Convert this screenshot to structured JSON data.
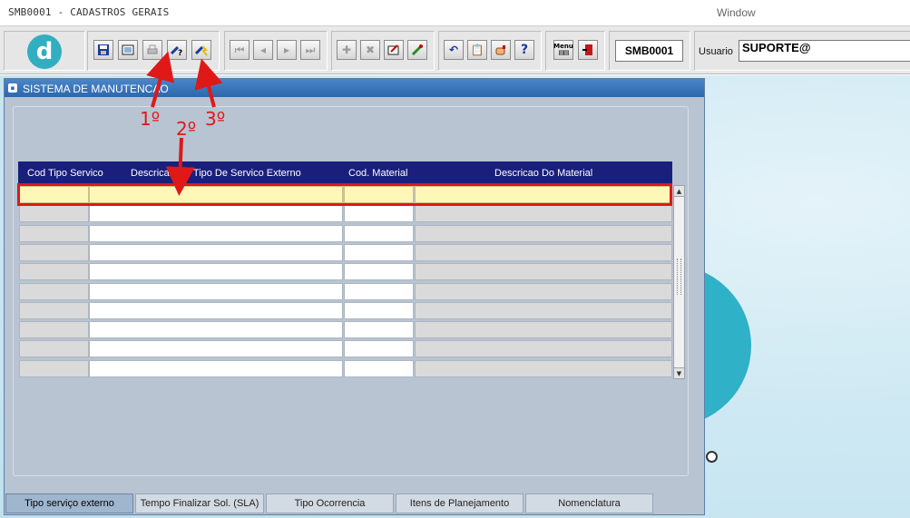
{
  "app": {
    "title": "SMB0001 - CADASTROS GERAIS",
    "menu_window": "Window"
  },
  "toolbar": {
    "logo_letter": "d",
    "form_code": "SMB0001",
    "user_label": "Usuario",
    "user_value": "SUPORTE@",
    "buttons": {
      "save": "save-icon",
      "clear": "clear-icon",
      "print": "print-icon",
      "query": "enter-query-icon",
      "execute": "execute-query-icon",
      "first": "first-record-icon",
      "prev": "previous-record-icon",
      "next": "next-record-icon",
      "last": "last-record-icon",
      "insert": "insert-record-icon",
      "delete": "delete-record-icon",
      "edit": "edit-icon",
      "lov": "list-of-values-icon",
      "undo": "undo-icon",
      "copy": "copy-icon",
      "hand": "hand-icon",
      "help": "help-icon",
      "menu": "menu-icon",
      "exit": "exit-icon"
    }
  },
  "window": {
    "title": "SISTEMA DE MANUTENCAO"
  },
  "grid": {
    "columns": [
      "Cod Tipo Servico",
      "Descricao Do Tipo De Servico Externo",
      "Cod. Material",
      "Descricao Do Material"
    ],
    "row_count": 10,
    "rows": [
      [
        "",
        "",
        "",
        ""
      ],
      [
        "",
        "",
        "",
        ""
      ],
      [
        "",
        "",
        "",
        ""
      ],
      [
        "",
        "",
        "",
        ""
      ],
      [
        "",
        "",
        "",
        ""
      ],
      [
        "",
        "",
        "",
        ""
      ],
      [
        "",
        "",
        "",
        ""
      ],
      [
        "",
        "",
        "",
        ""
      ],
      [
        "",
        "",
        "",
        ""
      ],
      [
        "",
        "",
        "",
        ""
      ]
    ]
  },
  "tabs": [
    {
      "label": "Tipo serviço externo",
      "active": true
    },
    {
      "label": "Tempo Finalizar Sol. (SLA)",
      "active": false
    },
    {
      "label": "Tipo Ocorrencia",
      "active": false
    },
    {
      "label": "Itens de Planejamento",
      "active": false
    },
    {
      "label": "Nomenclatura",
      "active": false
    }
  ],
  "annotations": {
    "step1": "1º",
    "step2": "2º",
    "step3": "3º",
    "color": "#e01818"
  },
  "colors": {
    "header_blue": "#1a1f7c",
    "window_title_blue": "#2d67ac",
    "highlight_yellow": "#fff7b8",
    "teal": "#31aebf"
  }
}
